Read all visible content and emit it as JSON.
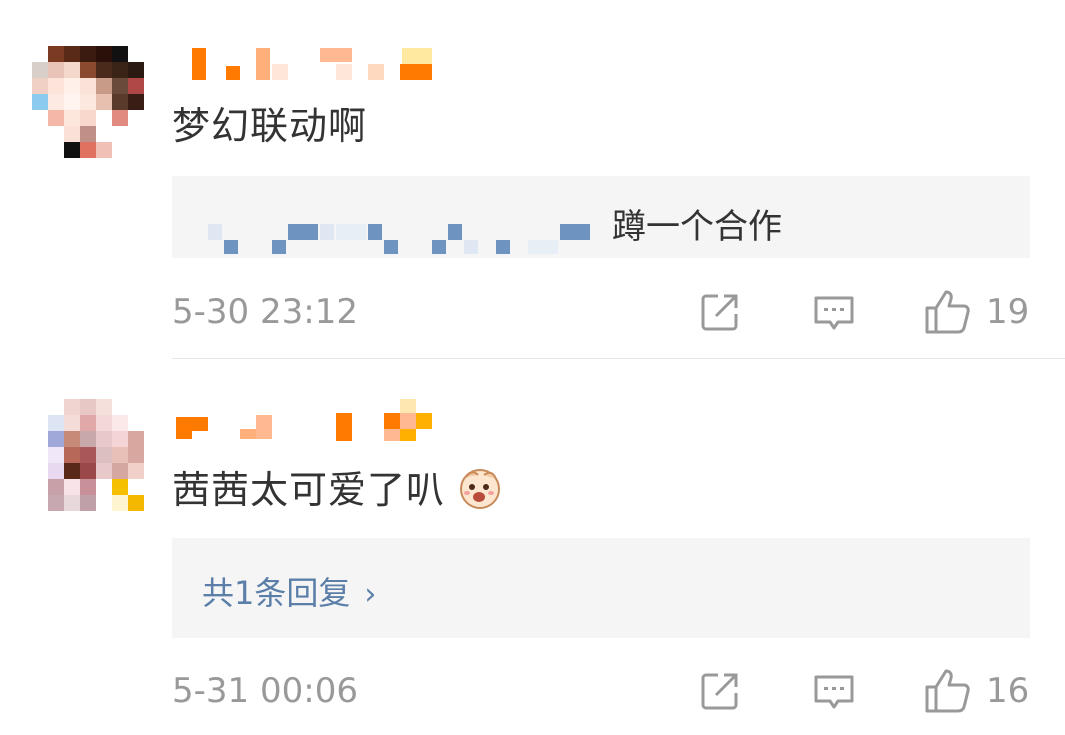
{
  "comments": [
    {
      "body": "梦幻联动啊",
      "reply_preview": "蹲一个合作",
      "timestamp": "5-30 23:12",
      "likes": "19"
    },
    {
      "body": "茜茜太可爱了叭",
      "reply_count_label": "共1条回复",
      "chevron": "›",
      "timestamp": "5-31 00:06",
      "likes": "16"
    }
  ],
  "icons": {
    "share": "share-icon",
    "comment": "comment-icon",
    "like": "thumbs-up-icon",
    "emoji": "laughing-face-emoji-icon"
  },
  "colors": {
    "text": "#333333",
    "meta": "#999999",
    "link": "#5b7fa8",
    "reply_bg": "#f5f5f5",
    "username_orange": "#ff7a00"
  }
}
